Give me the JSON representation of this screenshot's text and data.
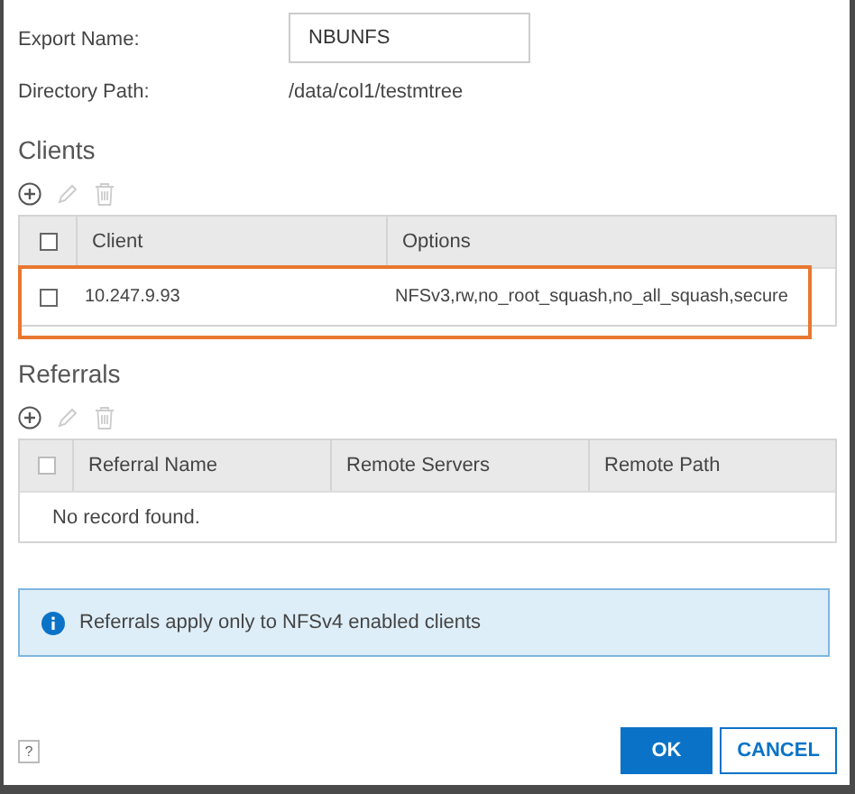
{
  "fields": [
    {
      "label": "Export Name:",
      "kind": "input",
      "value": "NBUNFS"
    },
    {
      "label": "Directory Path:",
      "kind": "text",
      "value": "/data/col1/testmtree"
    }
  ],
  "sections": [
    {
      "title": "Clients",
      "toolbar": [
        {
          "kind": "add",
          "disabled": false
        },
        {
          "kind": "edit",
          "disabled": true
        },
        {
          "kind": "delete",
          "disabled": true
        }
      ],
      "table": {
        "select_all": {
          "checked": false,
          "disabled": false
        },
        "columns": [
          "Client",
          "Options"
        ],
        "rows": [
          {
            "checked": false,
            "highlighted": true,
            "cells": [
              "10.247.9.93",
              "NFSv3,rw,no_root_squash,no_all_squash,secure"
            ]
          }
        ]
      }
    },
    {
      "title": "Referrals",
      "toolbar": [
        {
          "kind": "add",
          "disabled": false
        },
        {
          "kind": "edit",
          "disabled": true
        },
        {
          "kind": "delete",
          "disabled": true
        }
      ],
      "table": {
        "select_all": {
          "checked": false,
          "disabled": true
        },
        "columns": [
          "Referral Name",
          "Remote Servers",
          "Remote Path"
        ],
        "empty_message": "No record found."
      }
    }
  ],
  "info": "Referrals apply only to NFSv4 enabled clients",
  "help": "?",
  "buttons": [
    {
      "label": "OK",
      "kind": "primary"
    },
    {
      "label": "CANCEL",
      "kind": "secondary"
    }
  ]
}
